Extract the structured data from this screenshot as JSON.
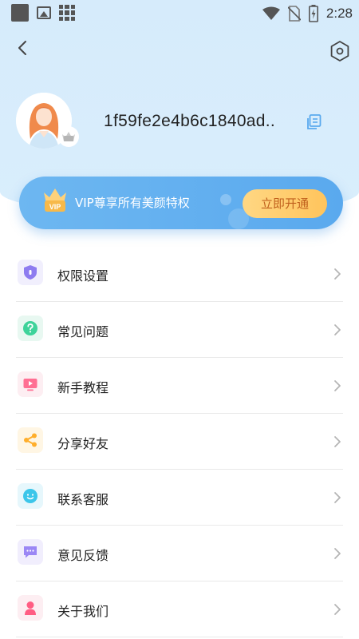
{
  "status_bar": {
    "time": "2:28",
    "icons": [
      "app-square-icon",
      "image-icon",
      "grid-icon",
      "wifi-icon",
      "no-sim-icon",
      "battery-charging-icon"
    ]
  },
  "nav": {
    "back_icon": "chevron-left-icon",
    "settings_icon": "hexagon-settings-icon"
  },
  "profile": {
    "user_id": "1f59fe2e4b6c1840ad..",
    "avatar_icon": "female-avatar-icon",
    "badge_icon": "crown-badge-icon",
    "copy_icon": "copy-icon"
  },
  "vip": {
    "badge_text": "VIP",
    "text": "VIP尊享所有美颜特权",
    "button_label": "立即开通",
    "colors": {
      "banner": "#5aa9ee",
      "button": "#ffc45c",
      "button_text": "#c0601d"
    }
  },
  "menu": {
    "items": [
      {
        "label": "权限设置",
        "icon": "shield-icon",
        "color": "#8e7cf0",
        "bg": "#f1effd"
      },
      {
        "label": "常见问题",
        "icon": "question-icon",
        "color": "#3ed39a",
        "bg": "#e8f8f1"
      },
      {
        "label": "新手教程",
        "icon": "play-icon",
        "color": "#ff6f93",
        "bg": "#fdeef2"
      },
      {
        "label": "分享好友",
        "icon": "share-icon",
        "color": "#ffae2b",
        "bg": "#fff6e4"
      },
      {
        "label": "联系客服",
        "icon": "smile-icon",
        "color": "#3cc6ea",
        "bg": "#e6f7fc"
      },
      {
        "label": "意见反馈",
        "icon": "chat-icon",
        "color": "#9b87f5",
        "bg": "#f1eefd"
      },
      {
        "label": "关于我们",
        "icon": "person-icon",
        "color": "#ff5d83",
        "bg": "#fdeef2"
      }
    ]
  }
}
